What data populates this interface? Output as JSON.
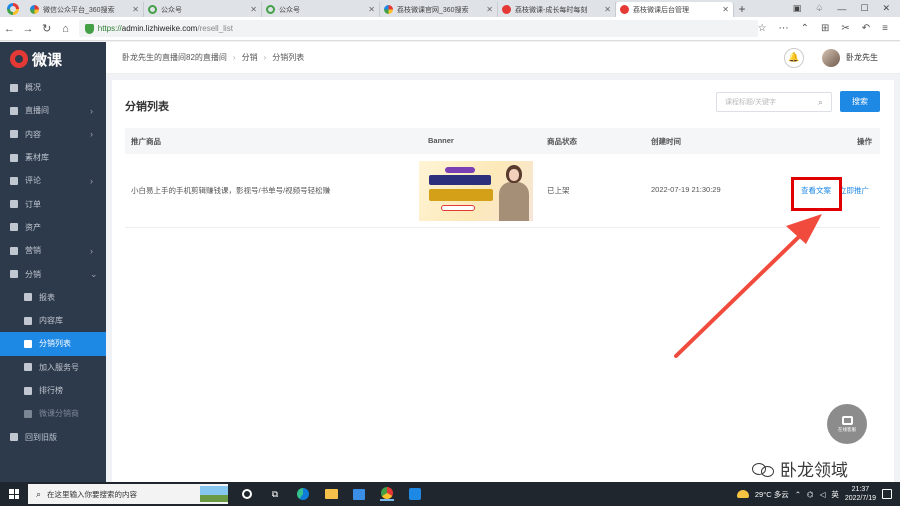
{
  "browser": {
    "tabs": [
      {
        "label": "微信公众平台_360搜索",
        "icon": "multi",
        "active": false
      },
      {
        "label": "公众号",
        "icon": "green",
        "active": false
      },
      {
        "label": "公众号",
        "icon": "green",
        "active": false
      },
      {
        "label": "荔枝微课官网_360搜索",
        "icon": "multi",
        "active": false
      },
      {
        "label": "荔枝微课-成长每时每刻",
        "icon": "red",
        "active": false
      },
      {
        "label": "荔枝微课后台管理",
        "icon": "red",
        "active": true
      }
    ],
    "url_scheme": "https://",
    "url_host": "admin.lizhiweike.com",
    "url_path": "/resell_list"
  },
  "sidebar": {
    "brand": "微课",
    "items": [
      {
        "label": "概况",
        "icon": "overview-icon",
        "arrow": ""
      },
      {
        "label": "直播间",
        "icon": "live-room-icon",
        "arrow": "›"
      },
      {
        "label": "内容",
        "icon": "content-icon",
        "arrow": "›"
      },
      {
        "label": "素材库",
        "icon": "material-icon",
        "arrow": ""
      },
      {
        "label": "评论",
        "icon": "comment-icon",
        "arrow": "›"
      },
      {
        "label": "订单",
        "icon": "order-icon",
        "arrow": ""
      },
      {
        "label": "资产",
        "icon": "asset-icon",
        "arrow": ""
      },
      {
        "label": "营销",
        "icon": "marketing-icon",
        "arrow": "›"
      },
      {
        "label": "分销",
        "icon": "distribution-icon",
        "arrow": "⌄"
      }
    ],
    "sub_items": [
      {
        "label": "报表",
        "icon": "report-icon",
        "active": false
      },
      {
        "label": "内容库",
        "icon": "library-icon",
        "active": false
      },
      {
        "label": "分销列表",
        "icon": "distribution-list-icon",
        "active": true
      },
      {
        "label": "加入服务号",
        "icon": "service-icon",
        "active": false
      },
      {
        "label": "排行榜",
        "icon": "ranking-icon",
        "active": false
      },
      {
        "label": "微课分销商",
        "icon": "reseller-icon",
        "active": false
      }
    ],
    "footer": {
      "label": "回到旧版",
      "icon": "old-version-icon"
    }
  },
  "header": {
    "breadcrumb": [
      "卧龙先生的直播间82的直播间",
      "分销",
      "分销列表"
    ],
    "username": "卧龙先生"
  },
  "main": {
    "title": "分销列表",
    "search_placeholder": "课程标题/关键字",
    "search_button": "搜索",
    "columns": [
      "推广商品",
      "Banner",
      "商品状态",
      "创建时间",
      "操作"
    ],
    "rows": [
      {
        "product": "小白易上手的手机剪辑赚钱课，影视号/书单号/视频号轻松赚",
        "status": "已上架",
        "created": "2022-07-19 21:30:29",
        "actions": [
          "查看文案",
          "立即推广"
        ]
      }
    ],
    "help_label": "在线客服"
  },
  "watermark": "卧龙领域",
  "taskbar": {
    "search_placeholder": "在这里输入你要搜索的内容",
    "weather": "29°C 多云",
    "ime": "英",
    "time": "21:37",
    "date": "2022/7/19"
  }
}
